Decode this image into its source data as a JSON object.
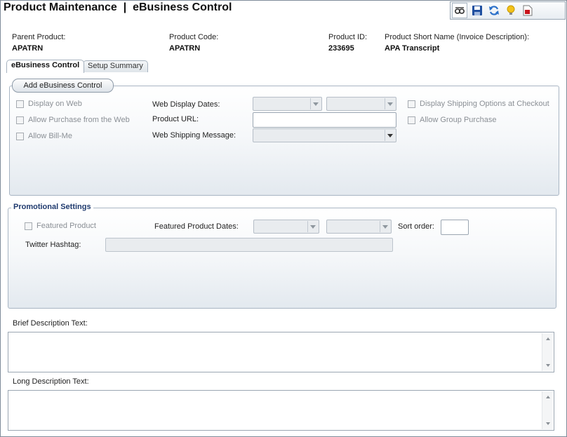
{
  "window": {
    "title_main": "Product Maintenance",
    "title_sep": "|",
    "title_sub": "eBusiness Control"
  },
  "toolbar": {
    "icons": [
      "view-icon",
      "save-icon",
      "refresh-icon",
      "lightbulb-icon",
      "pdf-icon"
    ]
  },
  "header": {
    "parent_product_label": "Parent Product:",
    "parent_product_value": "APATRN",
    "product_code_label": "Product Code:",
    "product_code_value": "APATRN",
    "product_id_label": "Product ID:",
    "product_id_value": "233695",
    "short_name_label": "Product Short Name (Invoice Description):",
    "short_name_value": "APA Transcript"
  },
  "tabs": [
    {
      "label": "eBusiness Control",
      "active": true
    },
    {
      "label": "Setup Summary",
      "active": false
    }
  ],
  "ebusiness": {
    "add_button": "Add eBusiness Control",
    "display_on_web": "Display on Web",
    "allow_purchase_web": "Allow Purchase from the Web",
    "allow_bill_me": "Allow Bill-Me",
    "web_display_dates_label": "Web Display Dates:",
    "product_url_label": "Product URL:",
    "product_url_value": "",
    "web_shipping_message_label": "Web Shipping Message:",
    "display_shipping_options": "Display Shipping Options at Checkout",
    "allow_group_purchase": "Allow Group Purchase"
  },
  "promotional": {
    "legend": "Promotional Settings",
    "featured_product": "Featured Product",
    "featured_dates_label": "Featured Product Dates:",
    "sort_order_label": "Sort order:",
    "sort_order_value": "",
    "twitter_hashtag_label": "Twitter Hashtag:",
    "twitter_hashtag_value": ""
  },
  "descriptions": {
    "brief_label": "Brief Description Text:",
    "brief_value": "",
    "long_label": "Long Description Text:",
    "long_value": ""
  },
  "colors": {
    "legend": "#1f3a6e",
    "panel_border": "#a8b5c3"
  }
}
